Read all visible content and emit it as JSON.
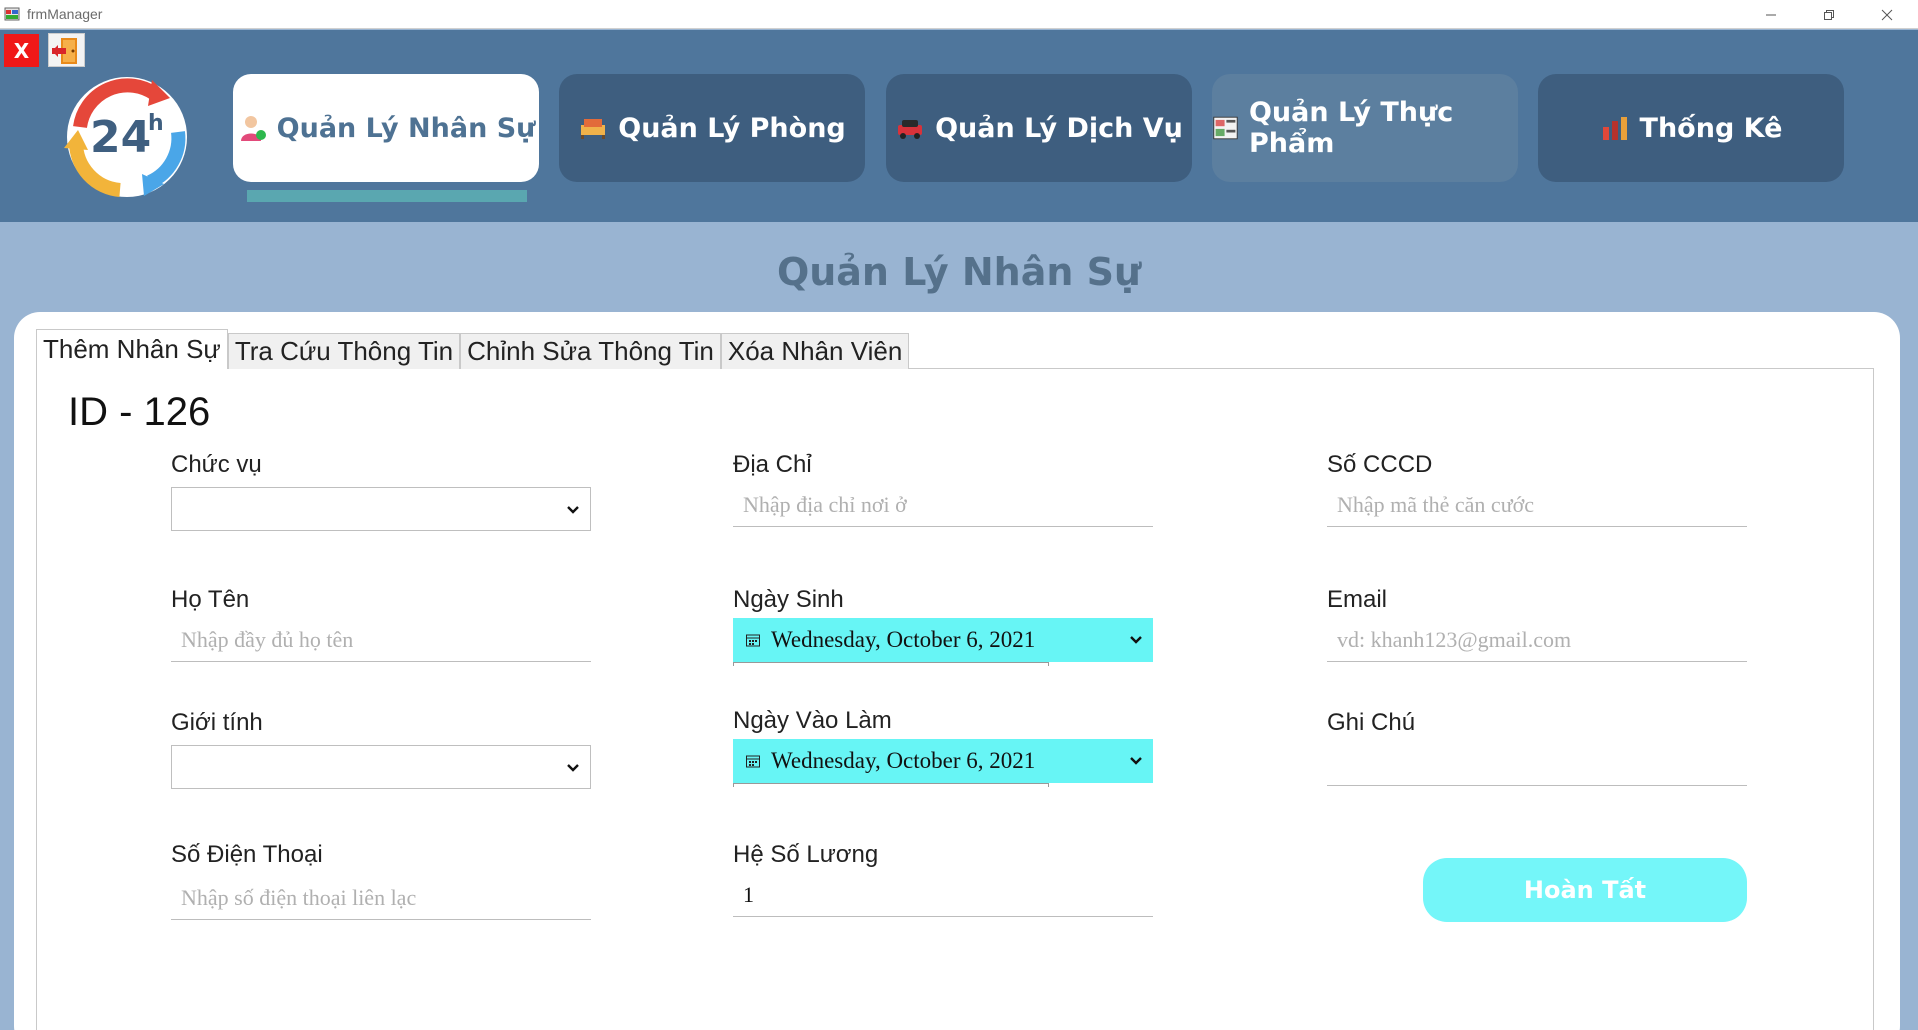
{
  "window": {
    "title": "frmManager"
  },
  "header": {
    "close_label": "X",
    "logo_text": "24",
    "logo_sup": "h",
    "nav": [
      {
        "label": "Quản Lý Nhân Sự",
        "icon": "user-icon",
        "active": true
      },
      {
        "label": "Quản Lý Phòng",
        "icon": "room-icon",
        "active": false
      },
      {
        "label": "Quản Lý Dịch Vụ",
        "icon": "car-service-icon",
        "active": false
      },
      {
        "label": "Quản Lý Thực Phẩm",
        "icon": "food-menu-icon",
        "active": false
      },
      {
        "label": "Thống Kê",
        "icon": "chart-icon",
        "active": false
      }
    ]
  },
  "page": {
    "title": "Quản Lý Nhân Sự"
  },
  "tabs": [
    "Thêm Nhân Sự",
    "Tra Cứu Thông Tin",
    "Chỉnh Sửa Thông Tin",
    "Xóa Nhân Viên"
  ],
  "form": {
    "id_label": "ID -  126",
    "chuc_vu": {
      "label": "Chức vụ",
      "value": ""
    },
    "ho_ten": {
      "label": "Họ Tên",
      "placeholder": "Nhập đầy đủ họ tên"
    },
    "gioi_tinh": {
      "label": "Giới tính",
      "value": ""
    },
    "so_dien_thoai": {
      "label": "Số Điện Thoại",
      "placeholder": "Nhập số điện thoại liên lạc"
    },
    "dia_chi": {
      "label": "Địa Chỉ",
      "placeholder": "Nhập địa chỉ nơi ở"
    },
    "ngay_sinh": {
      "label": "Ngày Sinh",
      "value": "Wednesday, October 6, 2021"
    },
    "ngay_vao_lam": {
      "label": "Ngày Vào Làm",
      "value": "Wednesday, October 6, 2021"
    },
    "he_so_luong": {
      "label": "Hệ Số Lương",
      "value": "1"
    },
    "so_cccd": {
      "label": "Số CCCD",
      "placeholder": "Nhập mã thẻ căn cước"
    },
    "email": {
      "label": "Email",
      "placeholder": "vd: khanh123@gmail.com"
    },
    "ghi_chu": {
      "label": "Ghi Chú",
      "value": ""
    },
    "submit_label": "Hoàn Tất"
  },
  "colors": {
    "header_bg": "#4f769c",
    "nav_btn": "#3e5e7f",
    "body_bg": "#99b4d2",
    "date_bg": "#67f5f5",
    "submit_bg": "#74f6f9",
    "close_red": "#f01818"
  }
}
